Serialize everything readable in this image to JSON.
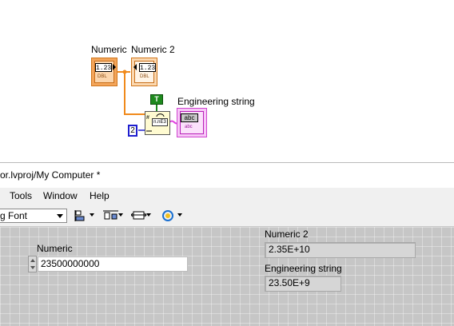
{
  "block_diagram": {
    "numeric_label": "Numeric",
    "numeric_value": "1.23",
    "numeric_type": "DBL",
    "numeric2_label": "Numeric 2",
    "numeric2_value": "1.23",
    "numeric2_type": "DBL",
    "true_constant": "T",
    "int_constant": "2",
    "format_function_text": "n.nE3",
    "eng_string_label": "Engineering string",
    "eng_string_value": "abc",
    "eng_string_type": "abc"
  },
  "window": {
    "title": "or.lvproj/My Computer *",
    "menu": [
      "Tools",
      "Window",
      "Help"
    ],
    "font_select": "g Font"
  },
  "front_panel": {
    "numeric_label": "Numeric",
    "numeric_value": "23500000000",
    "numeric2_label": "Numeric 2",
    "numeric2_value": "2.35E+10",
    "eng_string_label": "Engineering string",
    "eng_string_value": "23.50E+9"
  },
  "colors": {
    "dbl_wire": "#f08a1c",
    "string_wire": "#e040e0",
    "int_wire": "#1f1fcf",
    "bool_const": "#1e8a1e"
  }
}
